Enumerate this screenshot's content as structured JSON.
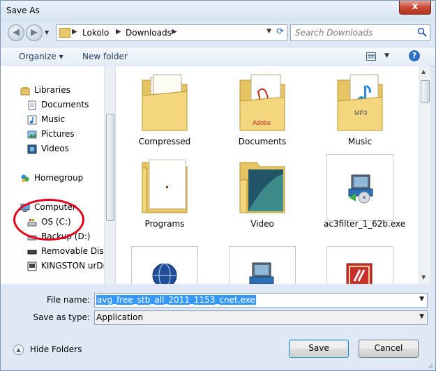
{
  "window": {
    "title": "Save As",
    "close_label": "x"
  },
  "nav": {
    "back_label": "◀",
    "forward_label": "▶",
    "address": {
      "crumbs": [
        "Lokolo",
        "Downloads"
      ]
    },
    "search_placeholder": "Search Downloads"
  },
  "toolbar": {
    "organize_label": "Organize ▾",
    "new_folder_label": "New folder",
    "help_label": "?"
  },
  "sidebar": {
    "items": [
      {
        "label": "Libraries",
        "icon": "libraries-icon"
      },
      {
        "label": "Documents",
        "icon": "documents-icon"
      },
      {
        "label": "Music",
        "icon": "music-icon"
      },
      {
        "label": "Pictures",
        "icon": "pictures-icon"
      },
      {
        "label": "Videos",
        "icon": "videos-icon"
      },
      {
        "label": "Homegroup",
        "icon": "homegroup-icon"
      },
      {
        "label": "Computer",
        "icon": "computer-icon"
      },
      {
        "label": "OS (C:)",
        "icon": "drive-icon"
      },
      {
        "label": "Backup (D:)",
        "icon": "drive-icon"
      },
      {
        "label": "Removable Disk (",
        "icon": "removable-disk-icon"
      },
      {
        "label": "KINGSTON urDriv",
        "icon": "usb-drive-icon"
      }
    ]
  },
  "files": [
    {
      "label": "Compressed",
      "icon": "folder-icon"
    },
    {
      "label": "Documents",
      "icon": "folder-pdf-icon",
      "badge": "Adobe"
    },
    {
      "label": "Music",
      "icon": "folder-music-icon",
      "badge": "MP3"
    },
    {
      "label": "Programs",
      "icon": "folder-icon"
    },
    {
      "label": "Video",
      "icon": "folder-video-icon"
    },
    {
      "label": "ac3filter_1_62b.exe",
      "icon": "installer-icon"
    },
    {
      "label": "",
      "icon": "globe-installer-icon"
    },
    {
      "label": "",
      "icon": "installer-icon"
    },
    {
      "label": "",
      "icon": "red-app-icon"
    }
  ],
  "form": {
    "filename_label": "File name:",
    "filename_value": "avg_free_stb_all_2011_1153_cnet.exe",
    "savetype_label": "Save as type:",
    "savetype_value": "Application"
  },
  "footer": {
    "hide_folders_label": "Hide Folders",
    "save_label": "Save",
    "cancel_label": "Cancel"
  },
  "colors": {
    "annotation_circle": "#e4001b",
    "selection": "#3399ff",
    "window_bg": "#dfe9f5"
  }
}
